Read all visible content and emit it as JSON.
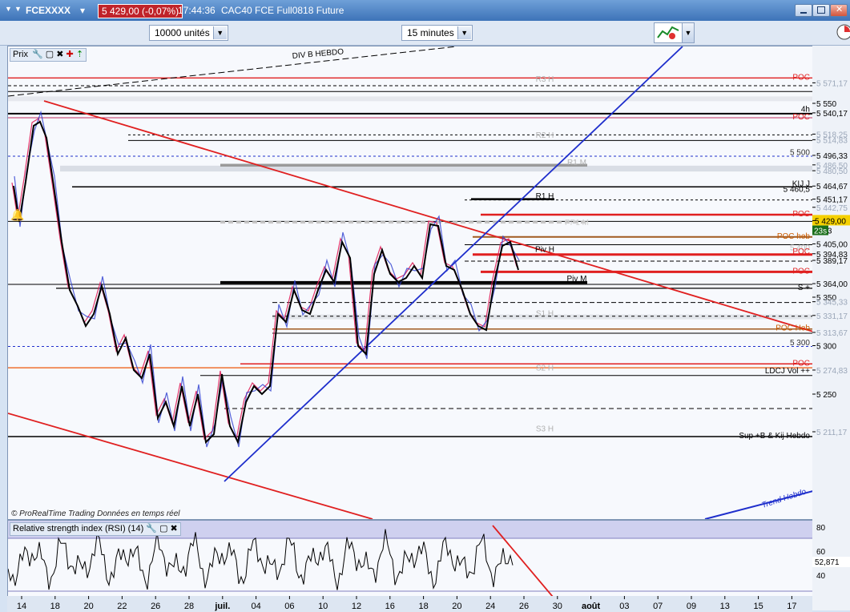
{
  "window": {
    "instrument": "FCEXXXX",
    "price_badge": "5 429,00 (-0,07%)",
    "time": "17:44:36",
    "description": "CAC40 FCE Full0818 Future"
  },
  "toolbar": {
    "units": "10000 unités",
    "timeframe": "15 minutes"
  },
  "price_panel": {
    "label": "Prix",
    "copyright": "© ProRealTime Trading  Données en temps réel"
  },
  "rsi_panel": {
    "label": "Relative strength index (RSI) (14)",
    "value": "52,871",
    "ticks": [
      "80",
      "60",
      "40"
    ]
  },
  "price_axis": [
    {
      "label": "5 571,17",
      "style": "grey",
      "price": 5571.17
    },
    {
      "label": "5 550",
      "style": "tick",
      "price": 5550
    },
    {
      "label": "5 540,17",
      "style": "black",
      "price": 5540.17
    },
    {
      "label": "5 518,25",
      "style": "grey",
      "price": 5518.25
    },
    {
      "label": "5 514,83",
      "style": "grey",
      "price": 5512.5
    },
    {
      "label": "5 496,33",
      "style": "black",
      "price": 5496.33
    },
    {
      "label": "5 486,50",
      "style": "grey",
      "price": 5486.5
    },
    {
      "label": "5 480,50",
      "style": "grey",
      "price": 5480.5
    },
    {
      "label": "5 464,67",
      "style": "black",
      "price": 5464.67
    },
    {
      "label": "5 451,17",
      "style": "black",
      "price": 5451.17
    },
    {
      "label": "5 442,75",
      "style": "grey",
      "price": 5442.75
    },
    {
      "label": "5 429,00",
      "style": "current",
      "price": 5429
    },
    {
      "label": "0,83",
      "style": "black",
      "price": 5419
    },
    {
      "label": "5 405,00",
      "style": "black",
      "price": 5405
    },
    {
      "label": "5 394,83",
      "style": "black",
      "price": 5394.83
    },
    {
      "label": "5 389,17",
      "style": "black",
      "price": 5388
    },
    {
      "label": "5 364,00",
      "style": "black",
      "price": 5364
    },
    {
      "label": "5 350",
      "style": "tick",
      "price": 5350
    },
    {
      "label": "5 345,33",
      "style": "grey",
      "price": 5345.33
    },
    {
      "label": "5 331,17",
      "style": "grey",
      "price": 5331.17
    },
    {
      "label": "5 313,67",
      "style": "grey",
      "price": 5313.67
    },
    {
      "label": "5 300",
      "style": "tick",
      "price": 5300
    },
    {
      "label": "5 274,83",
      "style": "grey",
      "price": 5274.83
    },
    {
      "label": "5 250",
      "style": "tick",
      "price": 5250
    },
    {
      "label": "5 211,17",
      "style": "grey",
      "price": 5211.17
    }
  ],
  "countdown": "23s",
  "level_labels": [
    {
      "text": "POC",
      "color": "#e02020",
      "price": 5577,
      "anchor": "right"
    },
    {
      "text": "R3 H",
      "color": "#b0b0b0",
      "price": 5575,
      "anchor": "mid"
    },
    {
      "text": "4h",
      "color": "#000000",
      "price": 5544,
      "anchor": "right"
    },
    {
      "text": "POC",
      "color": "#e02020",
      "price": 5536,
      "anchor": "right"
    },
    {
      "text": "R2 H",
      "color": "#b0b0b0",
      "price": 5517,
      "anchor": "mid"
    },
    {
      "text": "5 500",
      "color": "#333333",
      "price": 5499,
      "anchor": "right"
    },
    {
      "text": "R1 M",
      "color": "#b0b0b0",
      "price": 5489,
      "anchor": "midr"
    },
    {
      "text": "KIJ J",
      "color": "#000000",
      "price": 5467,
      "anchor": "right"
    },
    {
      "text": "5 460,5",
      "color": "#000000",
      "price": 5461,
      "anchor": "right"
    },
    {
      "text": "R1 H",
      "color": "#000000",
      "price": 5454,
      "anchor": "mid"
    },
    {
      "text": "POC",
      "color": "#e02020",
      "price": 5436,
      "anchor": "right"
    },
    {
      "text": "PP1 M",
      "color": "#d0d0d0",
      "price": 5427,
      "anchor": "midr"
    },
    {
      "text": "POC heb",
      "color": "#c85a00",
      "price": 5413,
      "anchor": "right"
    },
    {
      "text": "5 400",
      "color": "#c0c0c0",
      "price": 5401,
      "anchor": "right"
    },
    {
      "text": "Piv H",
      "color": "#000000",
      "price": 5399,
      "anchor": "mid"
    },
    {
      "text": "POC",
      "color": "#e02020",
      "price": 5397,
      "anchor": "right"
    },
    {
      "text": "POC",
      "color": "#e02020",
      "price": 5377,
      "anchor": "right"
    },
    {
      "text": "Piv M",
      "color": "#000000",
      "price": 5369,
      "anchor": "midr"
    },
    {
      "text": "S +",
      "color": "#000000",
      "price": 5360,
      "anchor": "right"
    },
    {
      "text": "S1 H",
      "color": "#b0b0b0",
      "price": 5333,
      "anchor": "mid"
    },
    {
      "text": "POC Heb",
      "color": "#c85a00",
      "price": 5318,
      "anchor": "right"
    },
    {
      "text": "5 300",
      "color": "#333333",
      "price": 5303,
      "anchor": "right"
    },
    {
      "text": "POC",
      "color": "#e02020",
      "price": 5282,
      "anchor": "right"
    },
    {
      "text": "S2 H",
      "color": "#b0b0b0",
      "price": 5277,
      "anchor": "mid"
    },
    {
      "text": "LDCJ  Vol ++",
      "color": "#000000",
      "price": 5274,
      "anchor": "right"
    },
    {
      "text": "S3 H",
      "color": "#b0b0b0",
      "price": 5214,
      "anchor": "mid"
    },
    {
      "text": "Sup +B  & Kij Hebdo",
      "color": "#000000",
      "price": 5207,
      "anchor": "right"
    }
  ],
  "trend_labels": {
    "div": "DIV B HEBDO",
    "trend": "Trend Hebdo"
  },
  "date_axis": [
    "14",
    "18",
    "20",
    "22",
    "26",
    "28",
    "juil.",
    "04",
    "06",
    "10",
    "12",
    "16",
    "18",
    "20",
    "24",
    "26",
    "30",
    "août",
    "03",
    "07",
    "09",
    "13",
    "15",
    "17"
  ],
  "colors": {
    "accent_red": "#e02020",
    "trend_blue": "#1f2fcc",
    "badge_red": "#c0232a",
    "candle_up": "#2a3cd0",
    "candle_down": "#e0205a"
  },
  "icons": [
    "wrench-icon",
    "window-icon",
    "close-icon",
    "plus-icon",
    "up-icon",
    "chart-type-icon",
    "alert-bell-icon"
  ]
}
